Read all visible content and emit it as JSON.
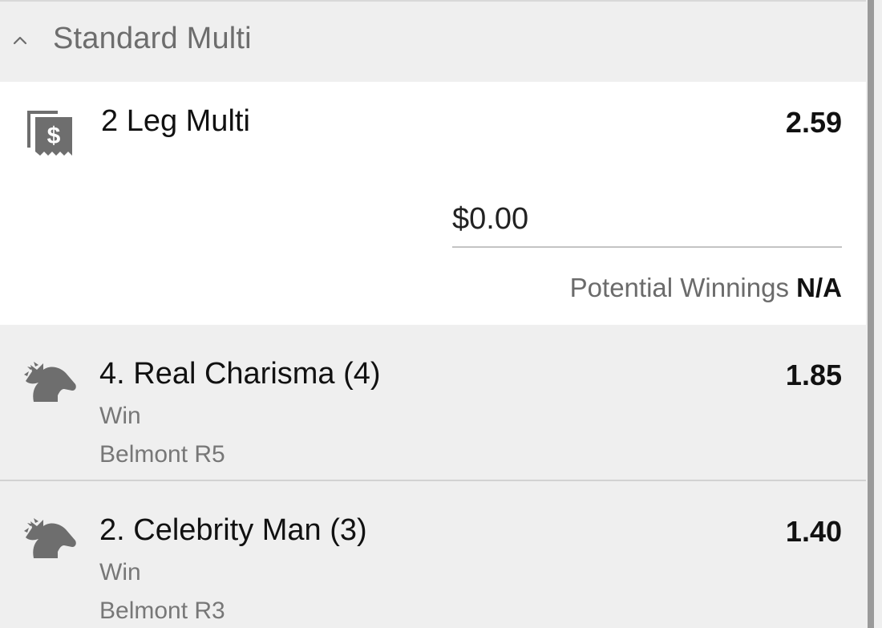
{
  "section": {
    "title": "Standard Multi",
    "chevron_icon": "chevron-up-icon"
  },
  "multi": {
    "icon": "receipt-dollar-icon",
    "title": "2 Leg Multi",
    "odds": "2.59",
    "stake_value": "$0.00",
    "winnings_label": "Potential Winnings",
    "winnings_value": "N/A"
  },
  "legs": [
    {
      "icon": "horse-head-icon",
      "title": "4. Real Charisma (4)",
      "bet_type": "Win",
      "race": "Belmont R5",
      "odds": "1.85"
    },
    {
      "icon": "horse-head-icon",
      "title": "2. Celebrity Man (3)",
      "bet_type": "Win",
      "race": "Belmont R3",
      "odds": "1.40"
    }
  ],
  "colors": {
    "background": "#efefef",
    "card": "#ffffff",
    "icon": "#6e6e6e",
    "muted_text": "#6d6d6d"
  }
}
